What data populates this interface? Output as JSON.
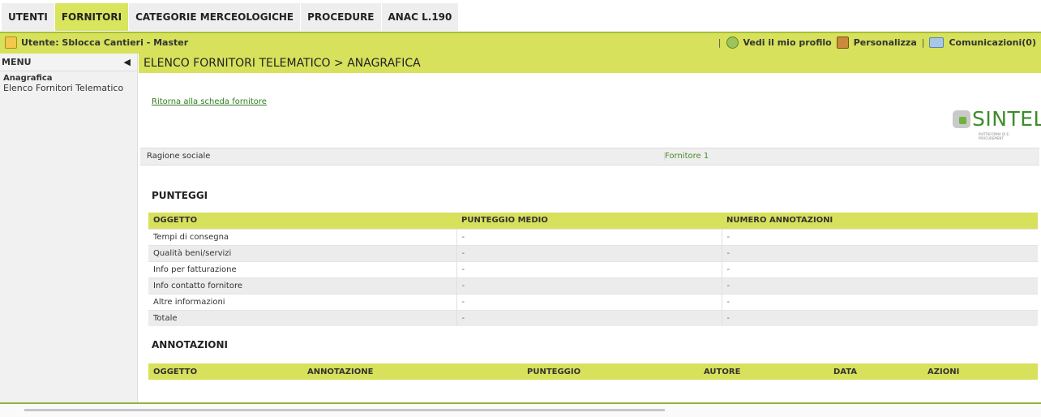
{
  "topnav": {
    "tabs": [
      {
        "label": "UTENTI"
      },
      {
        "label": "FORNITORI",
        "active": true
      },
      {
        "label": "CATEGORIE MERCEOLOGICHE"
      },
      {
        "label": "PROCEDURE"
      },
      {
        "label": "ANAC L.190"
      }
    ]
  },
  "userbar": {
    "user": "Utente: Sblocca Cantieri - Master",
    "profile": "Vedi il mio profilo",
    "customize": "Personalizza",
    "communications": "Comunicazioni(0)",
    "separator": "|"
  },
  "leftmenu": {
    "header": "MENU",
    "collapse_icon": "◀",
    "section": "Anagrafica",
    "item": "Elenco Fornitori Telematico"
  },
  "main": {
    "title": "ELENCO FORNITORI TELEMATICO  > ANAGRAFICA",
    "back_link": "Ritorna alla scheda fornitore",
    "logo": {
      "text": "SINTEL",
      "sub": "PIATTAFORMA DI E-PROCUREMENT"
    },
    "ragione": {
      "label": "Ragione sociale",
      "value": "Fornitore 1"
    },
    "punteggi": {
      "title": "PUNTEGGI",
      "headers": [
        "OGGETTO",
        "PUNTEGGIO MEDIO",
        "NUMERO ANNOTAZIONI"
      ],
      "rows": [
        [
          "Tempi di consegna",
          "-",
          "-"
        ],
        [
          "Qualità beni/servizi",
          "-",
          "-"
        ],
        [
          "Info per fatturazione",
          "-",
          "-"
        ],
        [
          "Info contatto fornitore",
          "-",
          "-"
        ],
        [
          "Altre informazioni",
          "-",
          "-"
        ],
        [
          "Totale",
          "-",
          "-"
        ]
      ]
    },
    "annotazioni": {
      "title": "ANNOTAZIONI",
      "headers": [
        "OGGETTO",
        "ANNOTAZIONE",
        "PUNTEGGIO",
        "AUTORE",
        "DATA",
        "AZIONI"
      ]
    }
  },
  "colors": {
    "accent": "#d7e15b",
    "brand_green": "#3d8b2b"
  }
}
